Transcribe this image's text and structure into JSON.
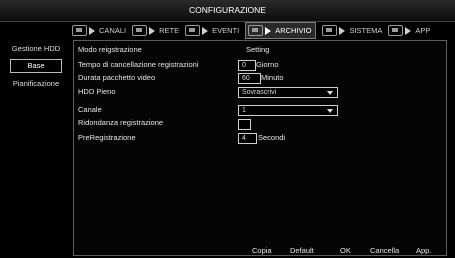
{
  "window": {
    "title": "CONFIGURAZIONE"
  },
  "tabs": [
    {
      "label": "CANALI",
      "active": false
    },
    {
      "label": "RETE",
      "active": false
    },
    {
      "label": "EVENTI",
      "active": false
    },
    {
      "label": "ARCHIVIO",
      "active": true
    },
    {
      "label": "SISTEMA",
      "active": false
    },
    {
      "label": "APP",
      "active": false
    }
  ],
  "sidebar": {
    "items": [
      {
        "label": "Gestione HDD"
      },
      {
        "label": "Base",
        "selected": true
      },
      {
        "label": "Pianificazione"
      }
    ]
  },
  "form": {
    "mode_label": "Modo reigstrazione",
    "mode_value": "Setting",
    "delete_label": "Tempo di cancellazione registrazioni",
    "delete_value": "0",
    "delete_unit": "Giorno",
    "packet_label": "Durata pacchetto video",
    "packet_value": "60",
    "packet_unit": "Minuto",
    "hdd_full_label": "HDD Pieno",
    "hdd_full_value": "Sovrascrivi",
    "channel_label": "Canale",
    "channel_value": "1",
    "redundancy_label": "Ridondanza registrazione",
    "redundancy_checked": false,
    "prerec_label": "PreRegistrazione",
    "prerec_value": "4",
    "prerec_unit": "Secondi"
  },
  "footer": {
    "copy": "Copia",
    "default": "Default",
    "ok": "OK",
    "cancel": "Cancella",
    "apply": "App."
  },
  "colors": {
    "background": "#000000",
    "border": "#5a5a5a",
    "text": "#e6e6e6"
  }
}
